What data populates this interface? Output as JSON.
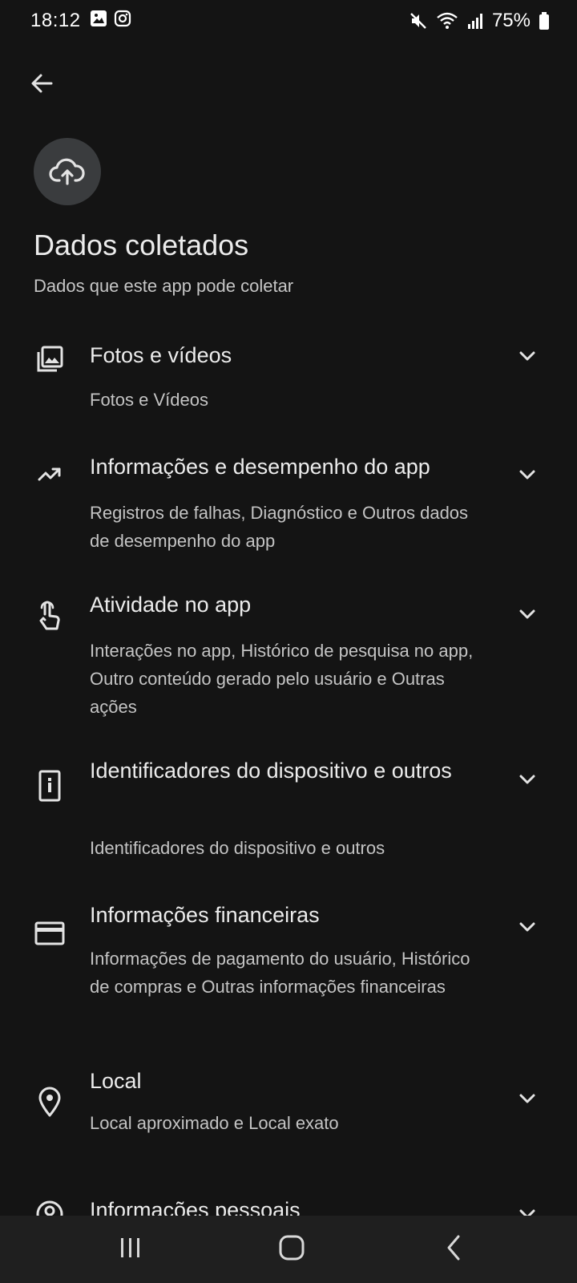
{
  "status_bar": {
    "time": "18:12",
    "battery_percent": "75%",
    "left_icons": [
      "gallery-icon",
      "instagram-icon"
    ],
    "right_icons": [
      "mute-icon",
      "wifi-icon",
      "signal-icon",
      "battery-icon"
    ]
  },
  "header": {
    "back_icon": "arrow-left-icon",
    "section_icon": "cloud-upload-icon",
    "title": "Dados coletados",
    "subtitle": "Dados que este app pode coletar"
  },
  "sections": [
    {
      "icon": "photo-library-icon",
      "title": "Fotos e vídeos",
      "description": "Fotos e Vídeos"
    },
    {
      "icon": "analytics-icon",
      "title": "Informações e desempenho do app",
      "description": "Registros de falhas, Diagnóstico e Outros dados de desempenho do app"
    },
    {
      "icon": "touch-icon",
      "title": "Atividade no app",
      "description": "Interações no app, Histórico de pesquisa no app, Outro conteúdo gerado pelo usuário e Outras ações"
    },
    {
      "icon": "device-info-icon",
      "title": "Identificadores do dispositivo e outros",
      "description": "Identificadores do dispositivo e outros"
    },
    {
      "icon": "credit-card-icon",
      "title": "Informações financeiras",
      "description": "Informações de pagamento do usuário, Histórico de compras e Outras informações financeiras"
    },
    {
      "icon": "location-pin-icon",
      "title": "Local",
      "description": "Local aproximado e Local exato"
    },
    {
      "icon": "account-circle-icon",
      "title": "Informações pessoais",
      "description": ""
    }
  ],
  "nav_bar": {
    "items": [
      "recent-apps-icon",
      "home-icon",
      "back-icon"
    ]
  },
  "colors": {
    "background": "#141414",
    "text_primary": "#ececec",
    "text_secondary": "#c4c4c4",
    "icon_circle": "#3a3c3e",
    "nav_background": "#1f1f1f"
  }
}
